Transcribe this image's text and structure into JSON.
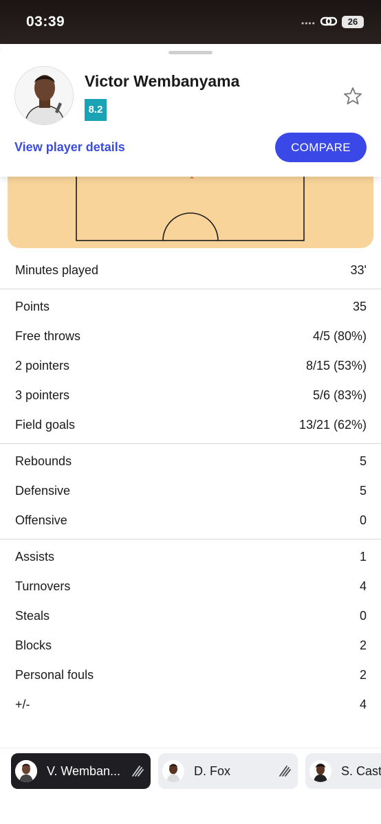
{
  "status_bar": {
    "time": "03:39",
    "battery": "26",
    "signal": "••••"
  },
  "player": {
    "name": "Victor Wembanyama",
    "rating": "8.2",
    "details_link": "View player details",
    "compare_label": "COMPARE"
  },
  "stats": {
    "minutes": [
      {
        "label": "Minutes played",
        "value": "33'"
      }
    ],
    "scoring": [
      {
        "label": "Points",
        "value": "35"
      },
      {
        "label": "Free throws",
        "value": "4/5 (80%)"
      },
      {
        "label": "2 pointers",
        "value": "8/15 (53%)"
      },
      {
        "label": "3 pointers",
        "value": "5/6 (83%)"
      },
      {
        "label": "Field goals",
        "value": "13/21 (62%)"
      }
    ],
    "rebounding": [
      {
        "label": "Rebounds",
        "value": "5"
      },
      {
        "label": "Defensive",
        "value": "5"
      },
      {
        "label": "Offensive",
        "value": "0"
      }
    ],
    "other": [
      {
        "label": "Assists",
        "value": "1"
      },
      {
        "label": "Turnovers",
        "value": "4"
      },
      {
        "label": "Steals",
        "value": "0"
      },
      {
        "label": "Blocks",
        "value": "2"
      },
      {
        "label": "Personal fouls",
        "value": "2"
      },
      {
        "label": "+/-",
        "value": "4"
      }
    ]
  },
  "player_tabs": [
    {
      "name": "V. Wemban...",
      "active": true
    },
    {
      "name": "D. Fox",
      "active": false
    },
    {
      "name": "S. Castl",
      "active": false
    }
  ],
  "colors": {
    "accent": "#3a48e8",
    "rating_bg": "#1aa3b5",
    "court": "#f8d49a",
    "active_tab": "#1f1f23"
  }
}
